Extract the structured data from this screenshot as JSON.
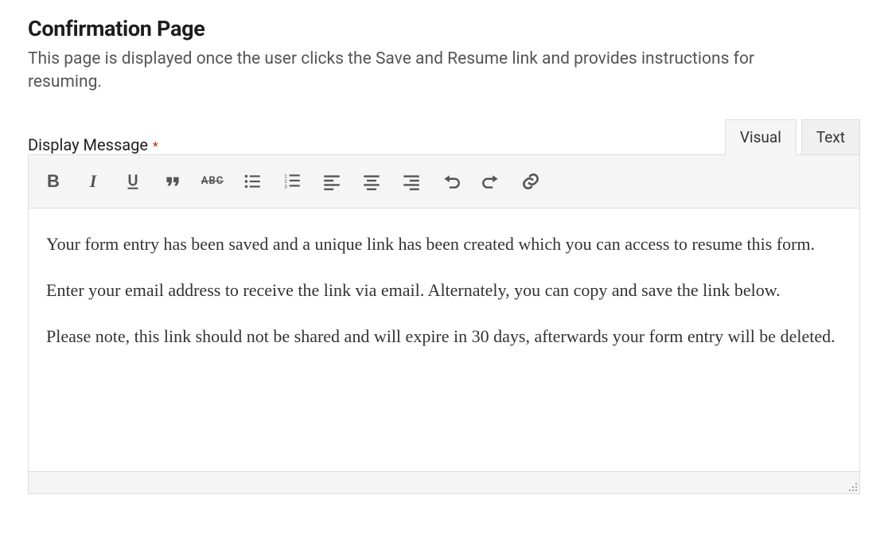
{
  "section": {
    "title": "Confirmation Page",
    "description": "This page is displayed once the user clicks the Save and Resume link and provides instructions for resuming."
  },
  "field": {
    "label": "Display Message",
    "required": "*"
  },
  "tabs": {
    "visual": "Visual",
    "text": "Text",
    "active": "visual"
  },
  "toolbar": {
    "bold": "B",
    "italic": "I",
    "underline": "U",
    "strike": "ABC"
  },
  "editor": {
    "p1": "Your form entry has been saved and a unique link has been created which you can access to resume this form.",
    "p2": "Enter your email address to receive the link via email. Alternately, you can copy and save the link below.",
    "p3": "Please note, this link should not be shared and will expire in 30 days, afterwards your form entry will be deleted."
  }
}
